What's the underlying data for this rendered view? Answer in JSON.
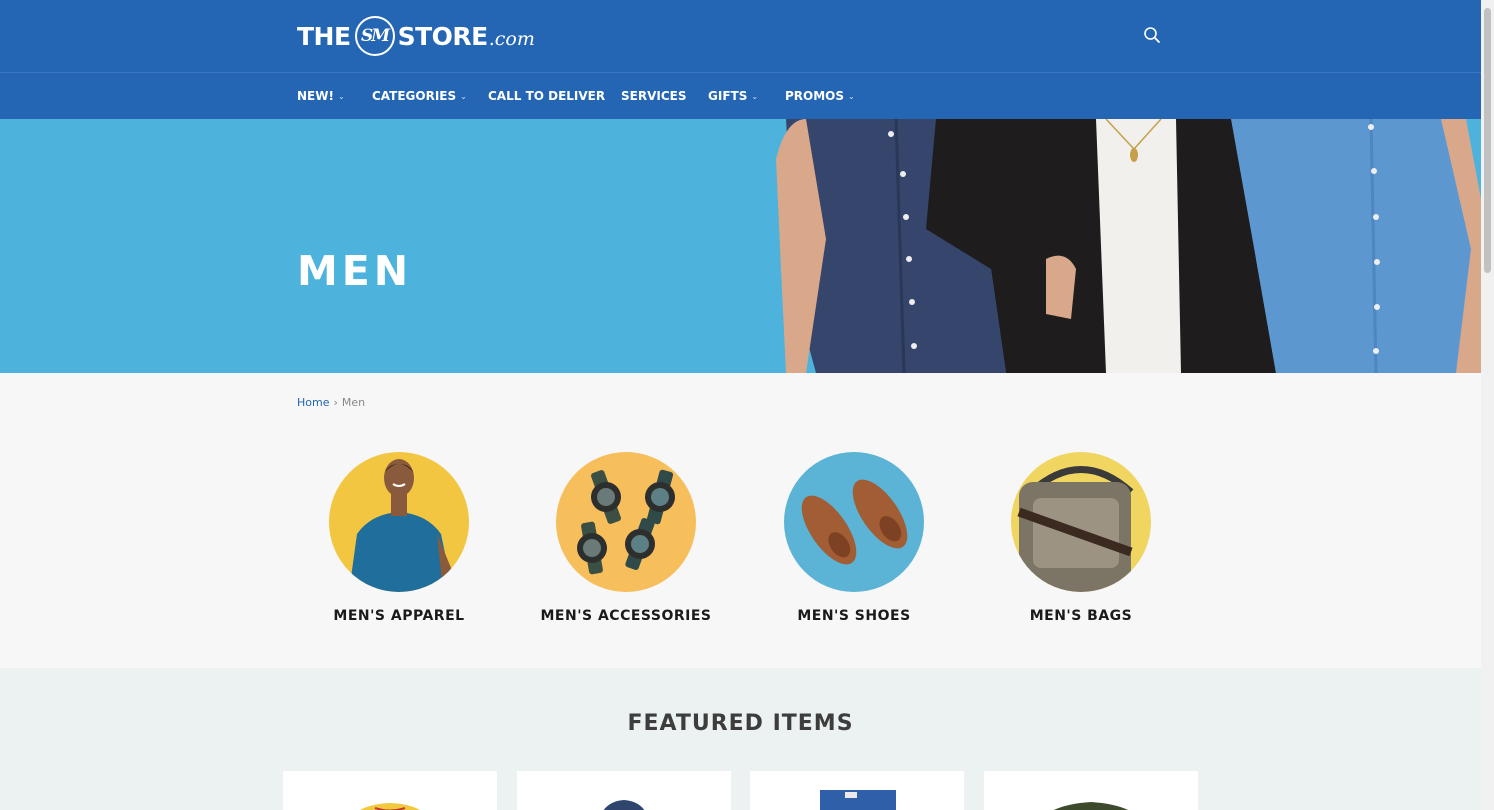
{
  "header": {
    "logo_the": "THE",
    "logo_badge": "SM",
    "logo_store": "STORE",
    "logo_com": ".com"
  },
  "nav": [
    {
      "label": "NEW!",
      "has_caret": true
    },
    {
      "label": "CATEGORIES",
      "has_caret": true
    },
    {
      "label": "CALL TO DELIVER",
      "has_caret": false
    },
    {
      "label": "SERVICES",
      "has_caret": false
    },
    {
      "label": "GIFTS",
      "has_caret": true
    },
    {
      "label": "PROMOS",
      "has_caret": true
    }
  ],
  "hero": {
    "title": "MEN"
  },
  "breadcrumb": {
    "home": "Home",
    "current": "Men"
  },
  "categories": [
    {
      "label": "MEN'S APPAREL",
      "bg": "#f2c640"
    },
    {
      "label": "MEN'S ACCESSORIES",
      "bg": "#f7be5c"
    },
    {
      "label": "MEN'S SHOES",
      "bg": "#5bb3d6"
    },
    {
      "label": "MEN'S BAGS",
      "bg": "#f0d561"
    }
  ],
  "featured": {
    "title": "FEATURED ITEMS"
  },
  "colors": {
    "brand_blue": "#2566b4",
    "hero_blue": "#4db3dc",
    "page_bg": "#f7f7f7",
    "featured_bg": "#ecf2f2"
  }
}
